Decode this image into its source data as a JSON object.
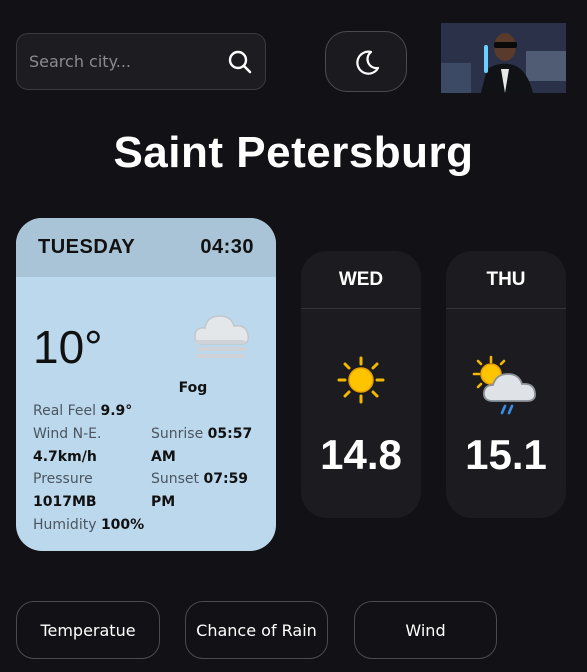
{
  "search": {
    "placeholder": "Search city..."
  },
  "city": "Saint Petersburg",
  "today": {
    "day": "TUESDAY",
    "time": "04:30",
    "temperature": "10°",
    "condition": "Fog",
    "real_feel_label": "Real Feel",
    "real_feel_value": "9.9°",
    "wind_label": "Wind N-E.",
    "wind_value": "4.7km/h",
    "pressure_label": "Pressure",
    "pressure_value": "1017MB",
    "humidity_label": "Humidity",
    "humidity_value": "100%",
    "sunrise_label": "Sunrise",
    "sunrise_value": "05:57",
    "sunrise_ampm": "AM",
    "sunset_label": "Sunset",
    "sunset_value": "07:59",
    "sunset_ampm": "PM"
  },
  "forecast": [
    {
      "day": "WED",
      "temperature": "14.8",
      "icon": "sun-icon"
    },
    {
      "day": "THU",
      "temperature": "15.1",
      "icon": "sun-cloud-rain-icon"
    }
  ],
  "tabs": [
    "Temperatue",
    "Chance of Rain",
    "Wind"
  ],
  "colors": {
    "background": "#121216",
    "today_card": "#bcd8ec",
    "today_header": "#a9c4d6",
    "forecast_card": "#1c1c20",
    "sun": "#f5b800"
  }
}
